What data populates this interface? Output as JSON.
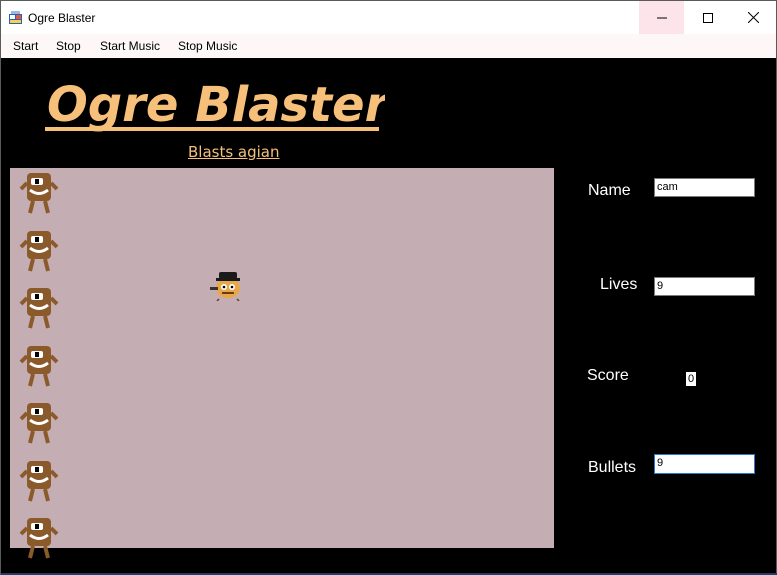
{
  "window": {
    "title": "Ogre Blaster"
  },
  "menu": {
    "items": [
      "Start",
      "Stop",
      "Start Music",
      "Stop Music"
    ]
  },
  "header": {
    "title": "Ogre Blaster",
    "subtitle": "Blasts agian"
  },
  "game": {
    "enemy_count": 7,
    "background_color": "#c4adb3"
  },
  "stats": {
    "name_label": "Name",
    "name_value": "cam",
    "lives_label": "Lives",
    "lives_value": "9",
    "score_label": "Score",
    "score_value": "0",
    "bullets_label": "Bullets",
    "bullets_value": "9"
  },
  "colors": {
    "title_fill": "#f7c07a",
    "background": "#000000",
    "ogre_body": "#8b5a2b"
  },
  "icons": [
    "app-icon",
    "minimize-icon",
    "maximize-icon",
    "close-icon",
    "ogre-icon",
    "player-icon"
  ]
}
